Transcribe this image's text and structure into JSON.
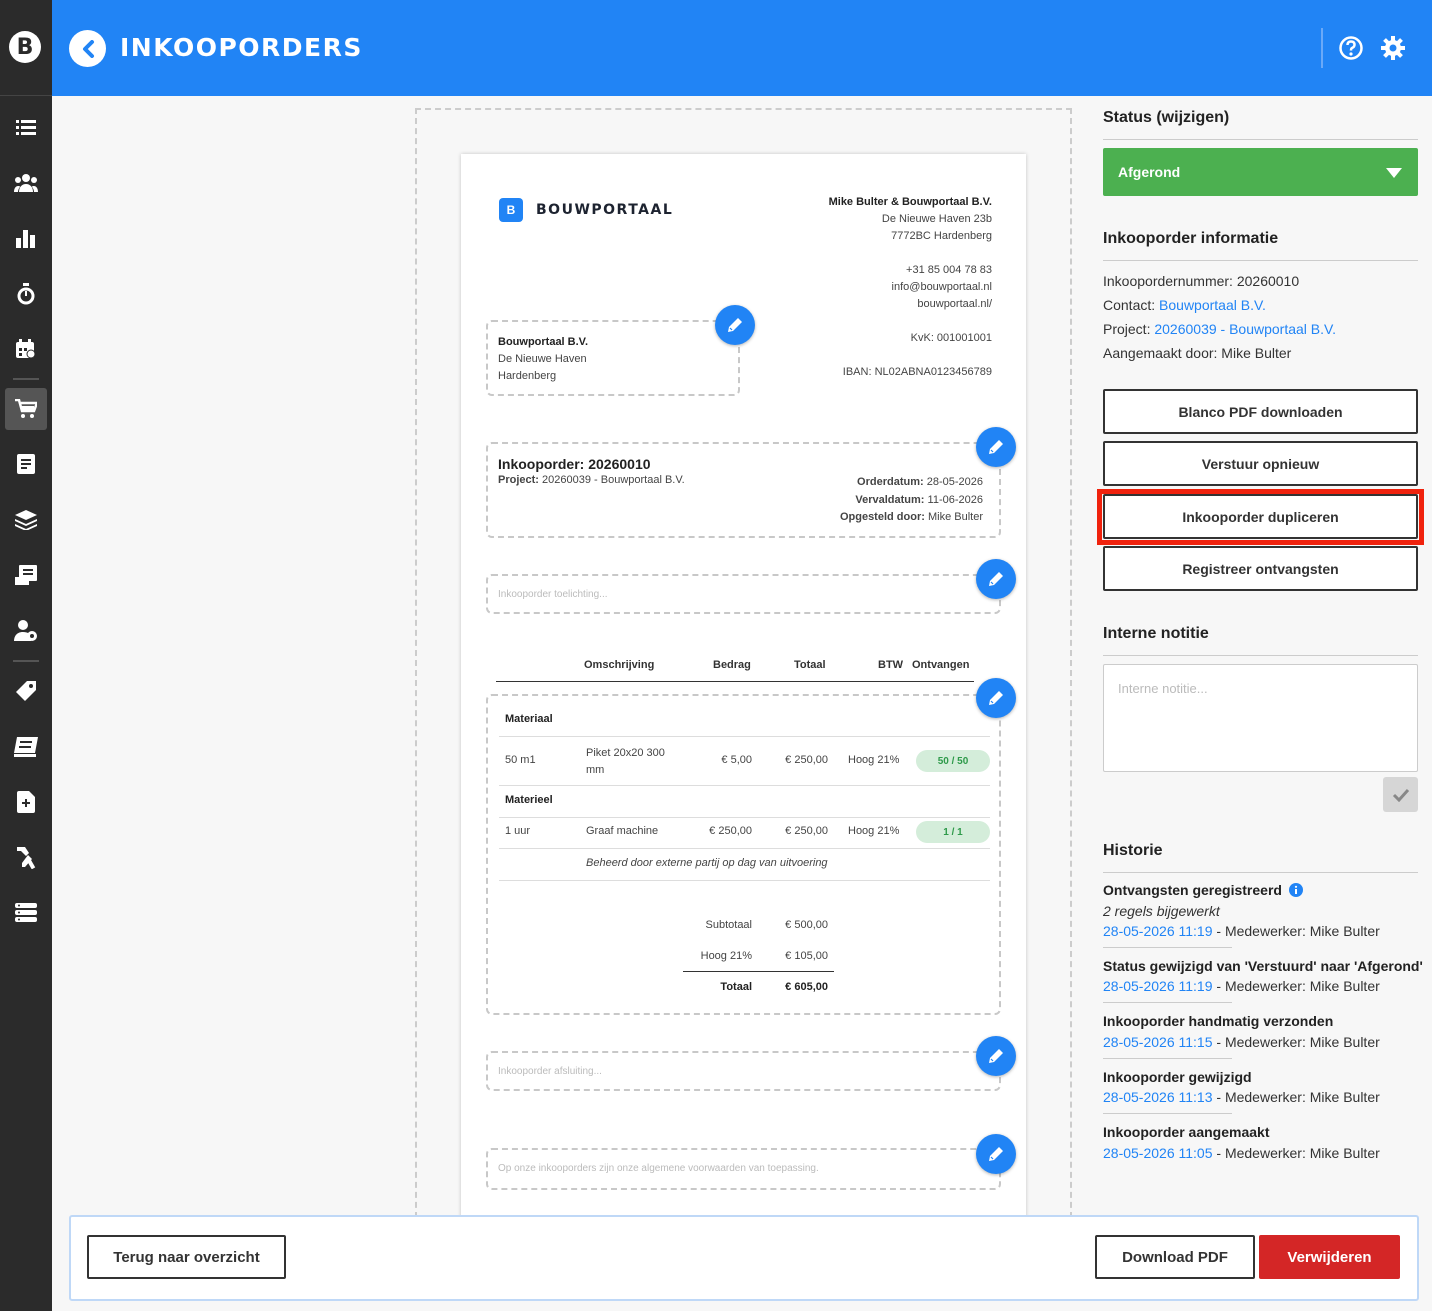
{
  "app": {
    "logo_letter": "B",
    "title": "INKOOPORDERS"
  },
  "sidebar": {
    "icons": [
      "list-icon",
      "users-icon",
      "bar-chart-icon",
      "stopwatch-icon",
      "calendar-icon",
      "cart-icon",
      "document-icon",
      "layers-icon",
      "invoice-icon",
      "user-settings-icon",
      "tag-icon",
      "book-icon",
      "file-plus-icon",
      "tools-icon",
      "server-icon"
    ],
    "active": "cart-icon"
  },
  "doc": {
    "brand": "BOUWPORTAAL",
    "company": {
      "name": "Mike Bulter & Bouwportaal B.V.",
      "street": "De Nieuwe Haven 23b",
      "city": "7772BC Hardenberg",
      "phone": "+31 85 004 78 83",
      "email": "info@bouwportaal.nl",
      "web": "bouwportaal.nl/",
      "kvk": "KvK: 001001001",
      "iban": "IBAN: NL02ABNA0123456789"
    },
    "recipient": {
      "name": "Bouwportaal B.V.",
      "street": "De Nieuwe Haven",
      "city": "Hardenberg"
    },
    "order": {
      "title": "Inkooporder: 20260010",
      "project_label": "Project:",
      "project_value": "20260039 - Bouwportaal B.V.",
      "orderdatum_label": "Orderdatum:",
      "orderdatum": "28-05-2026",
      "vervaldatum_label": "Vervaldatum:",
      "vervaldatum": "11-06-2026",
      "opgesteld_label": "Opgesteld door:",
      "opgesteld": "Mike Bulter"
    },
    "toelichting_placeholder": "Inkooporder toelichting...",
    "table": {
      "headers": {
        "omschrijving": "Omschrijving",
        "bedrag": "Bedrag",
        "totaal": "Totaal",
        "btw": "BTW",
        "ontvangen": "Ontvangen"
      },
      "groups": [
        {
          "name": "Materiaal",
          "rows": [
            {
              "qty": "50 m1",
              "desc": "Piket 20x20 300 mm",
              "bedrag": "€ 5,00",
              "totaal": "€ 250,00",
              "btw": "Hoog 21%",
              "ontvangen": "50 / 50"
            }
          ]
        },
        {
          "name": "Materieel",
          "rows": [
            {
              "qty": "1 uur",
              "desc": "Graaf machine",
              "bedrag": "€ 250,00",
              "totaal": "€ 250,00",
              "btw": "Hoog 21%",
              "ontvangen": "1 / 1",
              "note": "Beheerd door externe partij op dag van uitvoering"
            }
          ]
        }
      ],
      "subtotaal_label": "Subtotaal",
      "subtotaal": "€ 500,00",
      "btw_label": "Hoog 21%",
      "btw": "€ 105,00",
      "totaal_label": "Totaal",
      "totaal": "€ 605,00"
    },
    "afsluiting_placeholder": "Inkooporder afsluiting...",
    "voorwaarden": "Op onze inkooporders zijn onze algemene voorwaarden van toepassing."
  },
  "panel": {
    "status_title": "Status (wijzigen)",
    "status_value": "Afgerond",
    "status_color": "#4cb050",
    "info_title": "Inkooporder informatie",
    "nummer_label": "Inkoopordernummer:",
    "nummer": "20260010",
    "contact_label": "Contact:",
    "contact": "Bouwportaal B.V.",
    "project_label": "Project:",
    "project": "20260039 - Bouwportaal B.V.",
    "aangemaakt_label": "Aangemaakt door:",
    "aangemaakt": "Mike Bulter",
    "buttons": {
      "blanco": "Blanco PDF downloaden",
      "verstuur": "Verstuur opnieuw",
      "dupliceren": "Inkooporder dupliceren",
      "ontvangsten": "Registreer ontvangsten"
    },
    "notitie_title": "Interne notitie",
    "notitie_placeholder": "Interne notitie...",
    "historie_title": "Historie",
    "historie": [
      {
        "title": "Ontvangsten geregistreerd",
        "sub": "2 regels bijgewerkt",
        "date": "28-05-2026 11:19",
        "by": " - Medewerker: Mike Bulter"
      },
      {
        "title": "Status gewijzigd van 'Verstuurd' naar 'Afgerond'",
        "date": "28-05-2026 11:19",
        "by": " - Medewerker: Mike Bulter"
      },
      {
        "title": "Inkooporder handmatig verzonden",
        "date": "28-05-2026 11:15",
        "by": " - Medewerker: Mike Bulter"
      },
      {
        "title": "Inkooporder gewijzigd",
        "date": "28-05-2026 11:13",
        "by": " - Medewerker: Mike Bulter"
      },
      {
        "title": "Inkooporder aangemaakt",
        "date": "28-05-2026 11:05",
        "by": " - Medewerker: Mike Bulter"
      }
    ]
  },
  "footer": {
    "back": "Terug naar overzicht",
    "download": "Download PDF",
    "delete": "Verwijderen",
    "delete_color": "#d42626"
  }
}
